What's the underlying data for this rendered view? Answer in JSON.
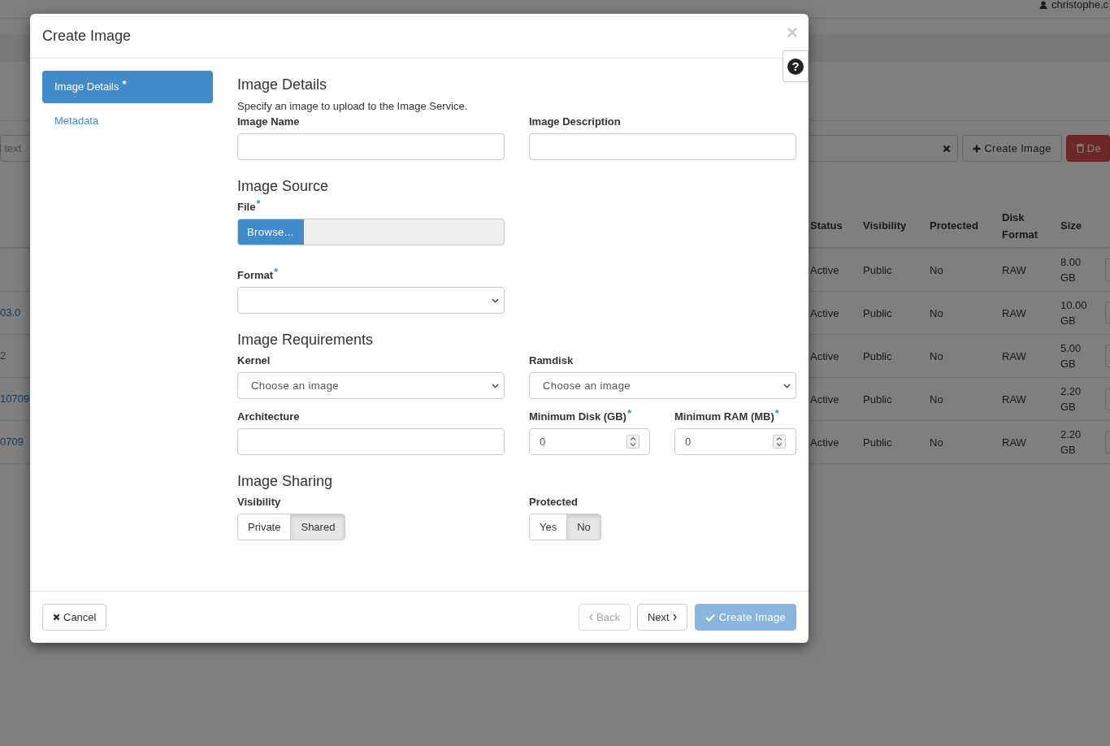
{
  "background": {
    "user": "christophe.c",
    "filter_placeholder": "l text",
    "toolbar_buttons": [
      {
        "label": "Create Image",
        "kind": "default"
      },
      {
        "label": "De",
        "kind": "danger"
      }
    ],
    "table": {
      "columns": [
        "Status",
        "Visibility",
        "Protected",
        "Disk Format",
        "Size"
      ],
      "rows": [
        {
          "status": "Active",
          "visibility": "Public",
          "protected": "No",
          "disk_format": "RAW",
          "size": "8.00 GB"
        },
        {
          "name": "03.0",
          "status": "Active",
          "visibility": "Public",
          "protected": "No",
          "disk_format": "RAW",
          "size": "10.00 GB"
        },
        {
          "name": "2",
          "status": "Active",
          "visibility": "Public",
          "protected": "No",
          "disk_format": "RAW",
          "size": "5.00 GB"
        },
        {
          "name": "10709",
          "status": "Active",
          "visibility": "Public",
          "protected": "No",
          "disk_format": "RAW",
          "size": "2.20 GB"
        },
        {
          "name": "0709",
          "status": "Active",
          "visibility": "Public",
          "protected": "No",
          "disk_format": "RAW",
          "size": "2.20 GB"
        }
      ]
    }
  },
  "modal": {
    "title": "Create Image",
    "close": "×",
    "help": "?",
    "steps": [
      {
        "label": "Image Details",
        "mark": "*",
        "selected": true
      },
      {
        "label": "Metadata",
        "selected": false
      }
    ],
    "sections": [
      {
        "title": "Image Details",
        "description": "Specify an image to upload to the Image Service.",
        "rows": [
          [
            {
              "kind": "text",
              "label": "Image Name"
            },
            {
              "kind": "text",
              "label": "Image Description"
            }
          ]
        ]
      },
      {
        "title": "Image Source",
        "rows": [
          [
            {
              "kind": "file",
              "label": "File",
              "mark": "*",
              "button": "Browse..."
            }
          ],
          [
            {
              "kind": "select",
              "label": "Format",
              "mark": "*"
            }
          ]
        ]
      },
      {
        "title": "Image Requirements",
        "rows": [
          [
            {
              "kind": "select",
              "label": "Kernel",
              "value": "Choose an image"
            },
            {
              "kind": "select",
              "label": "Ramdisk",
              "value": "Choose an image"
            }
          ],
          [
            {
              "kind": "text",
              "label": "Architecture"
            },
            {
              "kind": "number",
              "label": "Minimum Disk (GB)",
              "mark": "*",
              "value": "0"
            },
            {
              "kind": "number",
              "label": "Minimum RAM (MB)",
              "mark": "*",
              "value": "0"
            }
          ]
        ]
      },
      {
        "title": "Image Sharing",
        "rows": [
          [
            {
              "kind": "toggle",
              "label": "Visibility",
              "options": [
                {
                  "label": "Private",
                  "selected": false
                },
                {
                  "label": "Shared",
                  "selected": true
                }
              ]
            },
            {
              "kind": "toggle",
              "label": "Protected",
              "options": [
                {
                  "label": "Yes",
                  "selected": false
                },
                {
                  "label": "No",
                  "selected": true
                }
              ]
            }
          ]
        ]
      }
    ],
    "footer": {
      "cancel": "Cancel",
      "back": {
        "label": "Back",
        "disabled": true
      },
      "next": {
        "label": "Next",
        "disabled": false
      },
      "submit": {
        "label": "Create Image",
        "disabled": true
      }
    }
  }
}
